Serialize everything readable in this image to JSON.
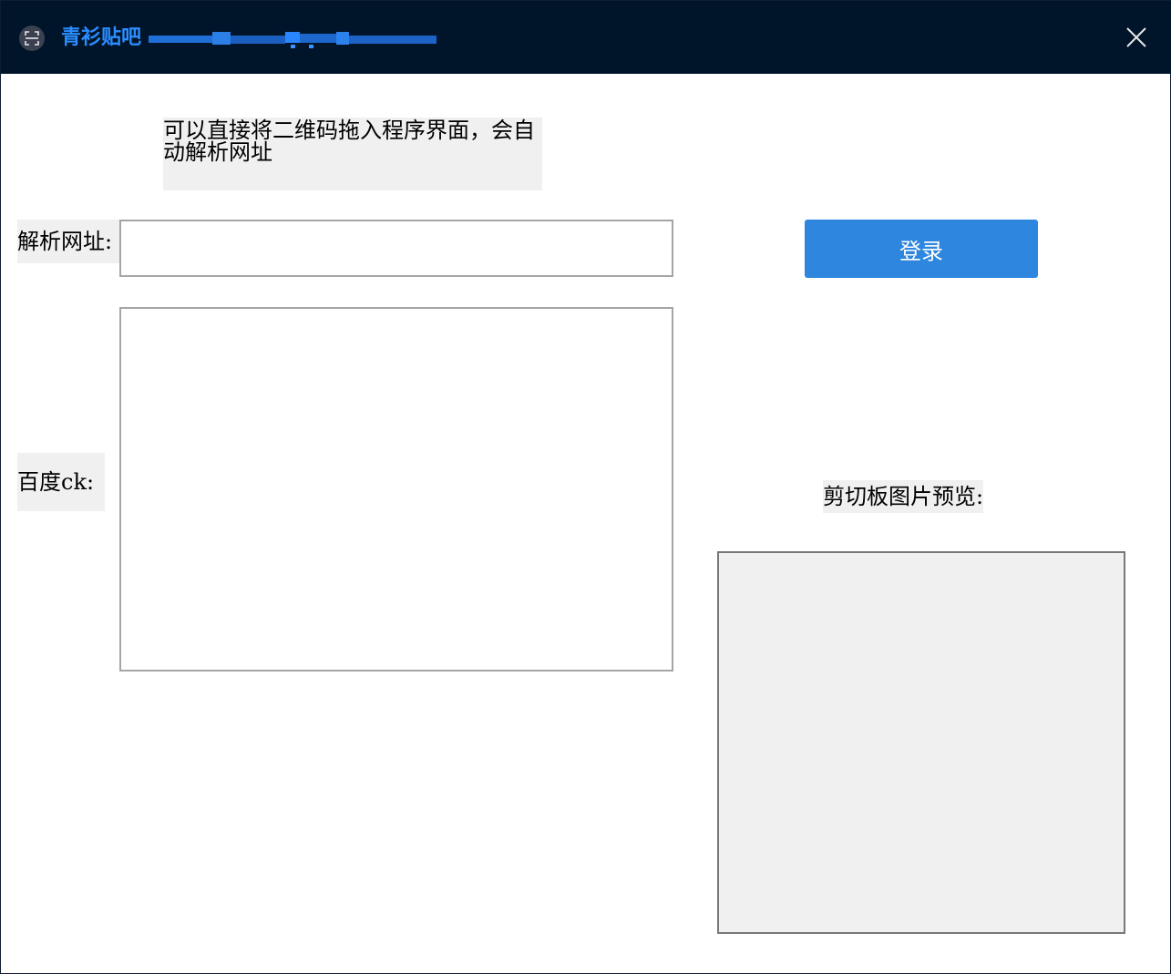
{
  "window": {
    "title": "青衫贴吧",
    "close_icon": "close-icon",
    "app_icon": "scan-icon"
  },
  "hint": {
    "text": "可以直接将二维码拖入程序界面，会自动解析网址"
  },
  "url_field": {
    "label": "解析网址:",
    "value": ""
  },
  "ck_field": {
    "label": "百度ck:",
    "value": ""
  },
  "login_button": {
    "label": "登录"
  },
  "clipboard": {
    "label": "剪切板图片预览:"
  },
  "colors": {
    "titlebar": "#00152a",
    "title_text": "#2b8dff",
    "button": "#2e86df",
    "panel_gray": "#f0f0f0"
  }
}
